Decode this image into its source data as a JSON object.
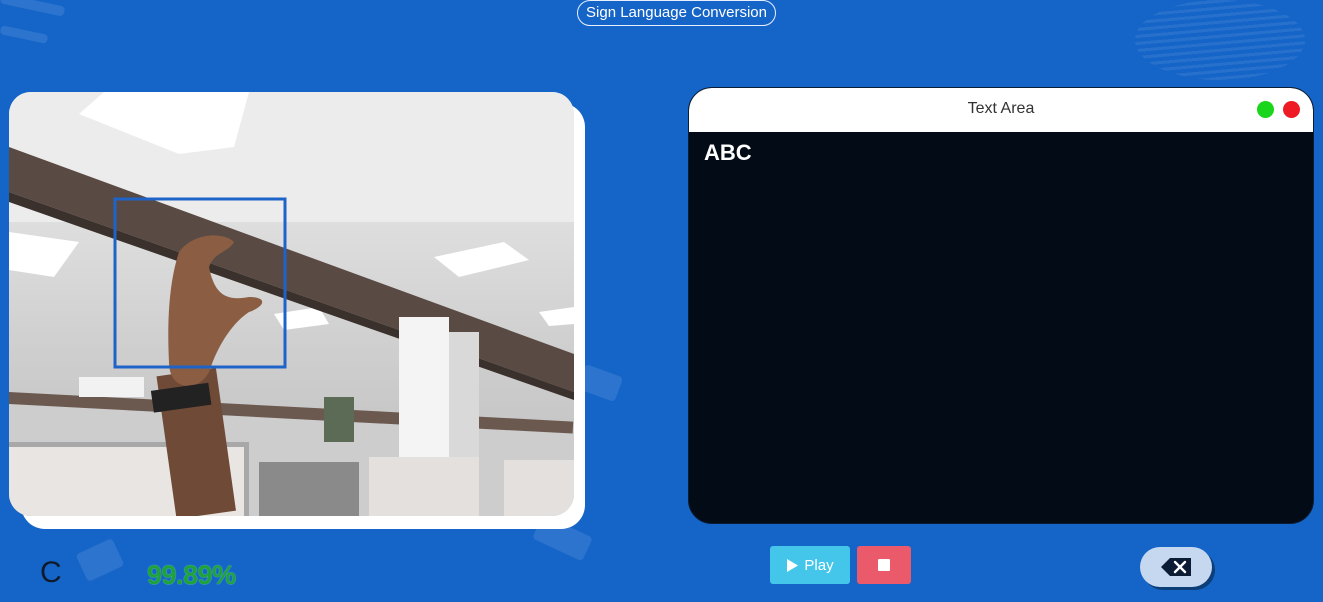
{
  "header": {
    "title": "Sign Language Conversion"
  },
  "camera": {
    "feed_icon": "camera-feed-image"
  },
  "text_area": {
    "title": "Text Area",
    "content": "ABC",
    "controls": {
      "maximize_color": "#19d51c",
      "close_color": "#ee1b24"
    }
  },
  "controls": {
    "play_label": "Play",
    "play_icon": "play-icon",
    "stop_icon": "stop-icon",
    "backspace_icon": "backspace-icon"
  },
  "prediction": {
    "letter": "C",
    "accuracy": "99.89%"
  },
  "colors": {
    "background": "#1565c8",
    "play_button": "#44c6ea",
    "stop_button": "#ea5a6b",
    "accuracy_text": "#1ea23a"
  }
}
